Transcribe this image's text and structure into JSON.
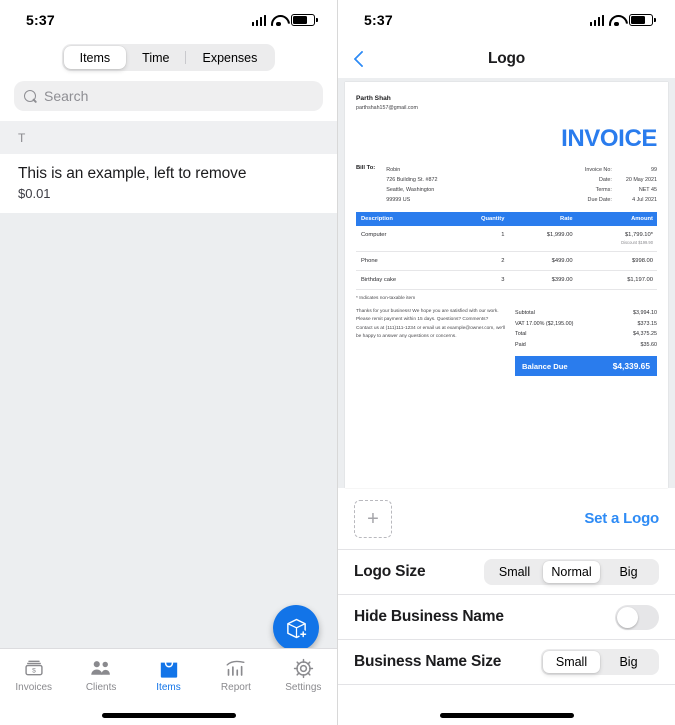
{
  "status": {
    "time": "5:37",
    "signal_icon": "cellular-signal-icon",
    "wifi_icon": "wifi-icon",
    "battery_icon": "battery-icon"
  },
  "left": {
    "segmented": {
      "options": [
        "Items",
        "Time",
        "Expenses"
      ],
      "selected": "Items"
    },
    "search": {
      "placeholder": "Search",
      "icon": "search-icon"
    },
    "section_header": "T",
    "items": [
      {
        "title": "This is an example, left to remove",
        "price": "$0.01"
      }
    ],
    "fab": {
      "icon": "add-box-icon"
    },
    "tabs": [
      {
        "label": "Invoices",
        "icon": "invoices-icon",
        "selected": false
      },
      {
        "label": "Clients",
        "icon": "clients-icon",
        "selected": false
      },
      {
        "label": "Items",
        "icon": "items-bag-icon",
        "selected": true
      },
      {
        "label": "Report",
        "icon": "report-chart-icon",
        "selected": false
      },
      {
        "label": "Settings",
        "icon": "settings-gear-icon",
        "selected": false
      }
    ]
  },
  "right": {
    "nav": {
      "back_icon": "back-chevron-icon",
      "title": "Logo"
    },
    "invoice": {
      "business_name": "Parth Shah",
      "business_email": "parthshah157@gmail.com",
      "heading": "INVOICE",
      "bill_to_label": "Bill To:",
      "bill_to_lines": [
        "Robin",
        "726 Building St. #872",
        "Seattle, Washington",
        "99999 US"
      ],
      "meta": [
        {
          "key": "Invoice No:",
          "value": "99"
        },
        {
          "key": "Date:",
          "value": "20 May 2021"
        },
        {
          "key": "Terms:",
          "value": "NET 45"
        },
        {
          "key": "Due Date:",
          "value": "4 Jul 2021"
        }
      ],
      "table_headers": [
        "Description",
        "Quantity",
        "Rate",
        "Amount"
      ],
      "line_items": [
        {
          "description": "Computer",
          "quantity": "1",
          "rate": "$1,999.00",
          "amount": "$1,799.10*",
          "note": "Discount $199.90"
        },
        {
          "description": "Phone",
          "quantity": "2",
          "rate": "$499.00",
          "amount": "$998.00",
          "note": ""
        },
        {
          "description": "Birthday cake",
          "quantity": "3",
          "rate": "$399.00",
          "amount": "$1,197.00",
          "note": ""
        }
      ],
      "nontaxable_note": "* Indicates non-taxable item",
      "footer_note": "Thanks for your business! We hope you are satisfied with our work. Please remit payment within 15 days. Questions? Comments? Contact us at (111)111-1234 or email us at example@owner.com, we'll be happy to answer any questions or concerns.",
      "totals": [
        {
          "key": "Subtotal",
          "value": "$3,994.10"
        },
        {
          "key": "VAT 17.00% ($2,195.00)",
          "value": "$373.15"
        },
        {
          "key": "Total",
          "value": "$4,375.25"
        },
        {
          "key": "Paid",
          "value": "$35.60"
        }
      ],
      "balance_label": "Balance Due",
      "balance_value": "$4,339.65"
    },
    "settings": {
      "set_logo_link": "Set a Logo",
      "add_logo_icon": "plus-icon",
      "logo_size": {
        "label": "Logo Size",
        "options": [
          "Small",
          "Normal",
          "Big"
        ],
        "selected": "Normal"
      },
      "hide_business_name": {
        "label": "Hide Business Name",
        "value": "off"
      },
      "business_name_size": {
        "label": "Business Name Size",
        "options": [
          "Small",
          "Big"
        ],
        "selected": "Small"
      }
    }
  },
  "colors": {
    "accent": "#2a7ced",
    "link": "#2e8bf5",
    "fab": "#1274e8",
    "tab_selected": "#1274e8"
  }
}
